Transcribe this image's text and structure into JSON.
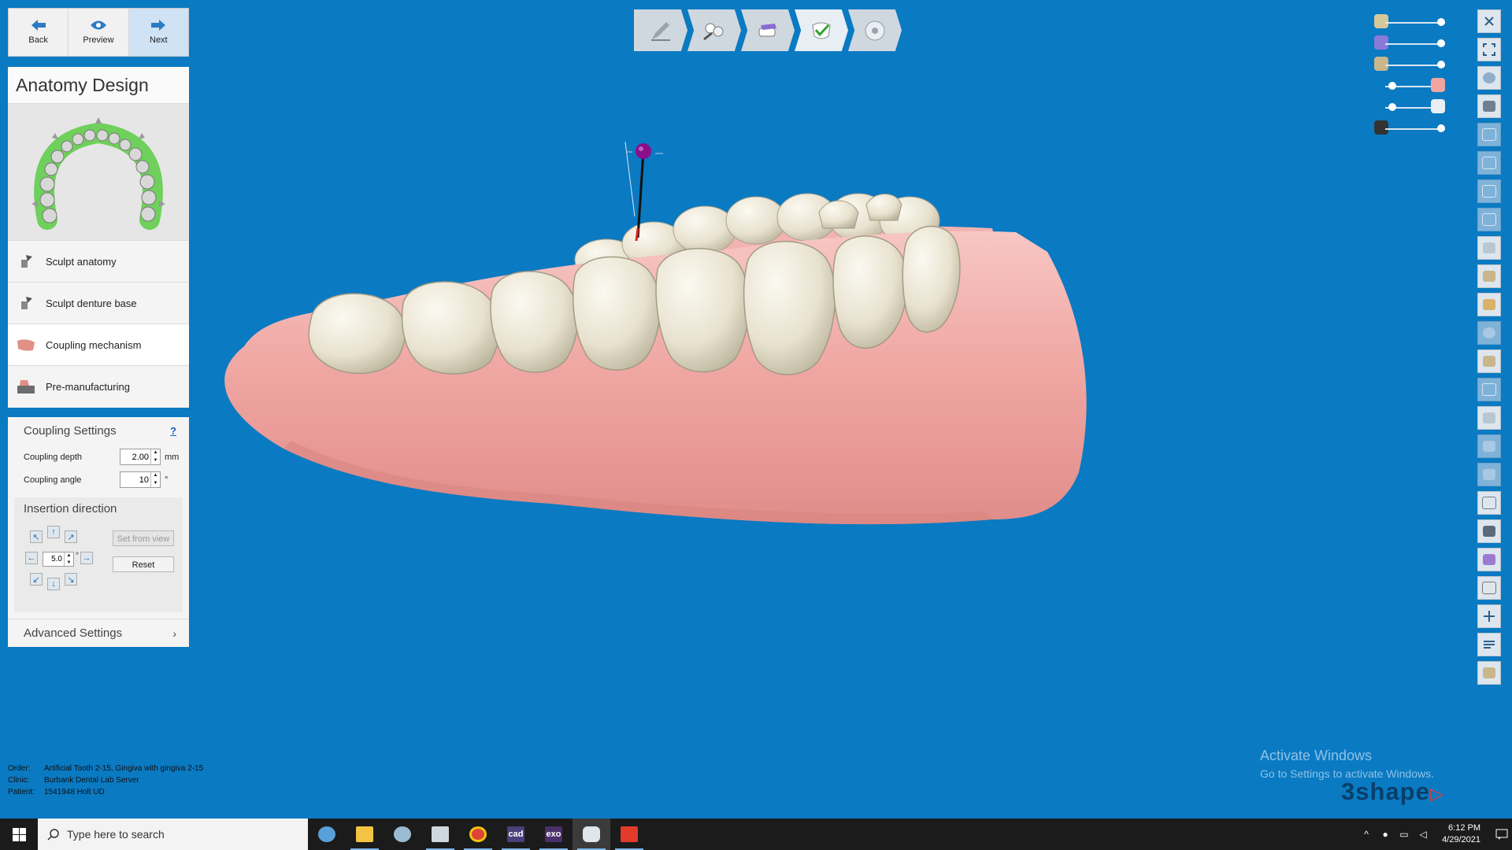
{
  "nav": {
    "back_label": "Back",
    "preview_label": "Preview",
    "next_label": "Next"
  },
  "panel": {
    "title": "Anatomy Design",
    "steps": [
      {
        "label": "Sculpt anatomy"
      },
      {
        "label": "Sculpt denture base"
      },
      {
        "label": "Coupling mechanism"
      },
      {
        "label": "Pre-manufacturing"
      }
    ]
  },
  "coupling": {
    "title": "Coupling Settings",
    "help": "?",
    "depth_label": "Coupling depth",
    "depth_value": "2.00",
    "depth_unit": "mm",
    "angle_label": "Coupling angle",
    "angle_value": "10",
    "angle_unit": "°"
  },
  "insertion": {
    "title": "Insertion direction",
    "step_value": "5.0",
    "step_unit": "°",
    "set_from_view_label": "Set from view",
    "reset_label": "Reset"
  },
  "advanced": {
    "label": "Advanced Settings",
    "chevron": "›"
  },
  "order_info": {
    "order_key": "Order:",
    "order_value": "Artificial Tooth 2-15, Gingiva with gingiva 2-15",
    "clinic_key": "Clinic:",
    "clinic_value": "Burbank Dental Lab Server",
    "patient_key": "Patient:",
    "patient_value": "1541948 Holt UD"
  },
  "watermark": {
    "line1": "Activate Windows",
    "line2": "Go to Settings to activate Windows."
  },
  "brand": {
    "text": "3shape",
    "mark": "▷"
  },
  "taskbar": {
    "search_placeholder": "Type here to search",
    "apps": [
      {
        "icon": "settings-app-icon",
        "color": "#5aa0d8"
      },
      {
        "icon": "file-explorer-icon",
        "color": "#f3c443"
      },
      {
        "icon": "app-icon",
        "color": "#9bbbd3"
      },
      {
        "icon": "dental-app-icon",
        "color": "#cfd8df"
      },
      {
        "icon": "chrome-icon",
        "color": "#db4437"
      },
      {
        "icon": "cad-icon",
        "color": "#4a3f7a",
        "text": "cad"
      },
      {
        "icon": "exo-icon",
        "color": "#4a2f6a",
        "text": "exo"
      },
      {
        "icon": "tooth-app-icon",
        "color": "#dfe6ec"
      },
      {
        "icon": "red-app-icon",
        "color": "#e23b2b"
      }
    ],
    "time": "6:12 PM",
    "date": "4/29/2021"
  },
  "colors": {
    "background": "#0a7ac2",
    "gingiva": "#f0aaa6",
    "teeth": "#ece8d9",
    "pin": "#8a0f8a",
    "brand": "#083f6b"
  }
}
